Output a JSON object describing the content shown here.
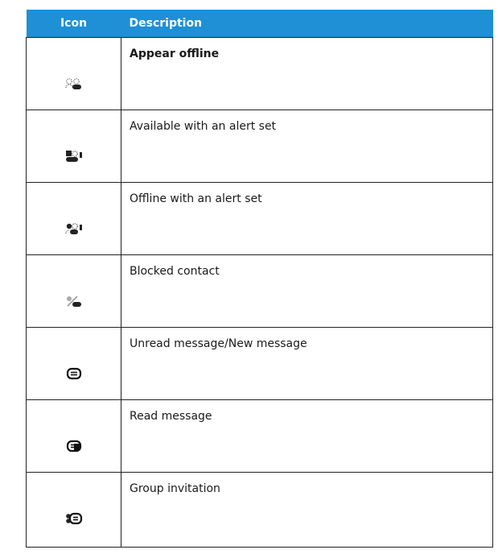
{
  "table": {
    "headers": {
      "icon": "Icon",
      "description": "Description"
    },
    "rows": [
      {
        "icon": "appear-offline-icon",
        "description": "Appear offline",
        "bold": true
      },
      {
        "icon": "available-alert-icon",
        "description": "Available with an alert set",
        "bold": false
      },
      {
        "icon": "offline-alert-icon",
        "description": "Offline with an alert set",
        "bold": false
      },
      {
        "icon": "blocked-contact-icon",
        "description": "Blocked contact",
        "bold": false
      },
      {
        "icon": "unread-message-icon",
        "description": "Unread message/New message",
        "bold": false
      },
      {
        "icon": "read-message-icon",
        "description": "Read message",
        "bold": false
      },
      {
        "icon": "group-invitation-icon",
        "description": "Group invitation",
        "bold": false
      }
    ]
  },
  "colors": {
    "header_bg": "#1f8fd6",
    "header_text": "#ffffff",
    "border": "#222222"
  }
}
